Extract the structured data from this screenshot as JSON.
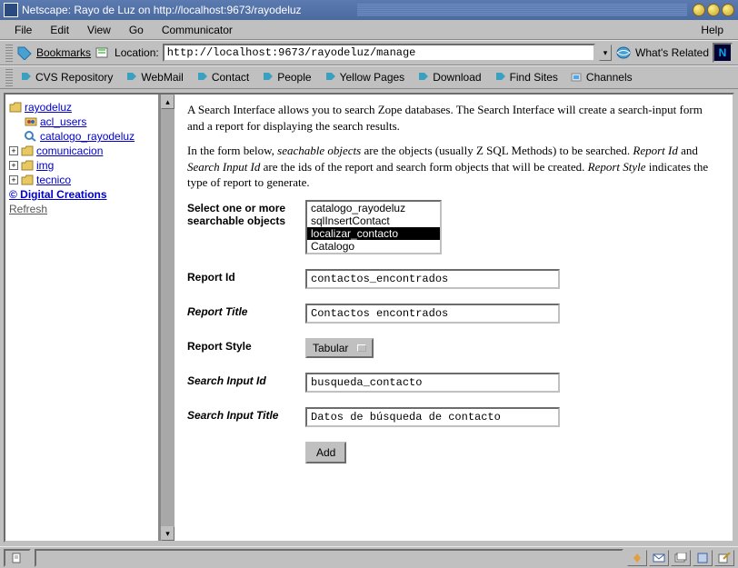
{
  "title": "Netscape: Rayo de Luz on http://localhost:9673/rayodeluz",
  "menubar": {
    "file": "File",
    "edit": "Edit",
    "view": "View",
    "go": "Go",
    "communicator": "Communicator",
    "help": "Help"
  },
  "toolbar1": {
    "bookmarks": "Bookmarks",
    "location_label": "Location:",
    "url": "http://localhost:9673/rayodeluz/manage",
    "whats_related": "What's Related"
  },
  "toolbar2": {
    "cvs": "CVS Repository",
    "webmail": "WebMail",
    "contact": "Contact",
    "people": "People",
    "yellow": "Yellow Pages",
    "download": "Download",
    "find": "Find Sites",
    "channels": "Channels"
  },
  "sidebar": {
    "root": "rayodeluz",
    "acl": "acl_users",
    "catalogo": "catalogo_rayodeluz",
    "comunicacion": "comunicacion",
    "img": "img",
    "tecnico": "tecnico",
    "dc": "© Digital Creations",
    "refresh": "Refresh"
  },
  "main": {
    "p1a": "A Search Interface allows you to search Zope databases. The Search Interface will create a search-input form and a report for displaying the search results.",
    "p2a": "In the form below, ",
    "p2b": "seachable objects",
    "p2c": " are the objects (usually Z SQL Methods) to be searched. ",
    "p2d": "Report Id",
    "p2e": " and ",
    "p2f": "Search Input Id",
    "p2g": " are the ids of the report and search form objects that will be created. ",
    "p2h": "Report Style",
    "p2i": " indicates the type of report to generate."
  },
  "form": {
    "select_label": "Select one or more searchable objects",
    "list": {
      "i0": "catalogo_rayodeluz",
      "i1": "sqlInsertContact",
      "i2": "localizar_contacto",
      "i3": "Catalogo"
    },
    "report_id_label": "Report Id",
    "report_id": "contactos_encontrados",
    "report_title_label": "Report Title",
    "report_title": "Contactos encontrados",
    "report_style_label": "Report Style",
    "report_style": "Tabular",
    "search_id_label": "Search Input Id",
    "search_id": "busqueda_contacto",
    "search_title_label": "Search Input Title",
    "search_title": "Datos de búsqueda de contacto",
    "add": "Add"
  }
}
